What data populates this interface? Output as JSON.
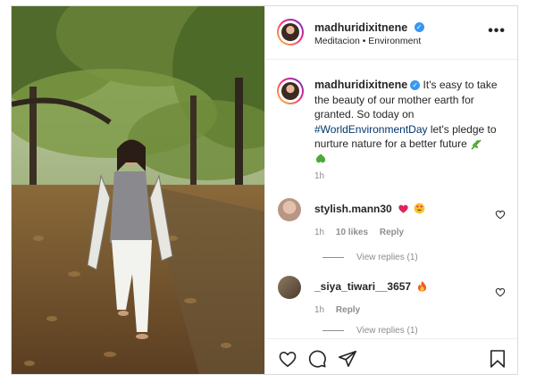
{
  "post": {
    "username": "madhuridixitnene",
    "header_subtitle": "Meditacion • Environment",
    "more_label": "•••",
    "caption": {
      "username": "madhuridixitnene",
      "text_before": " It's easy to take the beauty of our mother earth for granted. So today on ",
      "hashtag": "#WorldEnvironmentDay",
      "text_after": " let's pledge to nurture nature for a better future",
      "emojis": [
        "herb-emoji",
        "green-heart-emoji"
      ],
      "time": "1h"
    }
  },
  "comments": [
    {
      "username": "stylish.mann30",
      "emojis": [
        "red-heart-emoji",
        "heart-eyes-emoji"
      ],
      "time": "1h",
      "likes": "10 likes",
      "reply_label": "Reply",
      "view_replies": "View replies (1)"
    },
    {
      "username": "_siya_tiwari__3657",
      "emojis": [
        "fire-emoji"
      ],
      "time": "1h",
      "likes": "",
      "reply_label": "Reply",
      "view_replies": "View replies (1)"
    }
  ],
  "actions": {
    "icons": [
      "heart-icon",
      "comment-icon",
      "share-icon",
      "bookmark-icon"
    ]
  },
  "colors": {
    "verified": "#3897f0",
    "hashtag": "#00376b",
    "muted": "#8e8e8e",
    "border": "#dbdbdb"
  }
}
